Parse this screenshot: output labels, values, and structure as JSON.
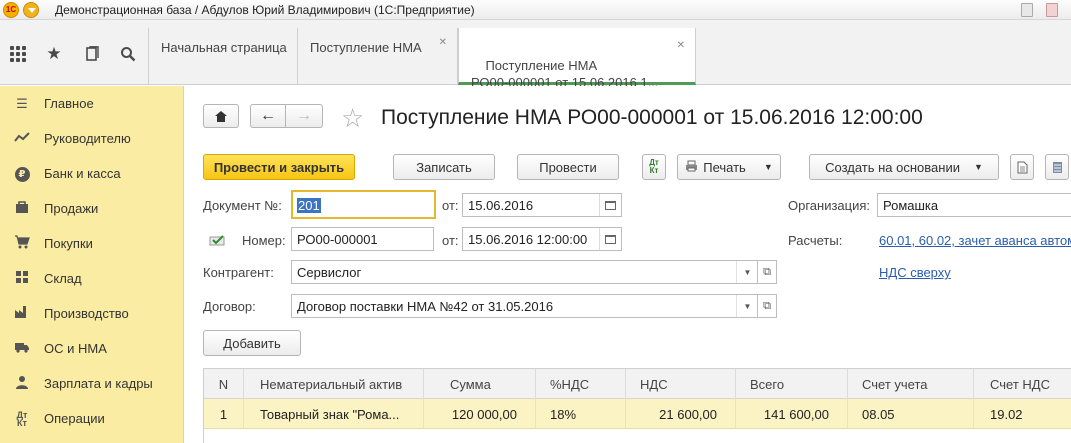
{
  "window": {
    "logo_text": "1С",
    "title": "Демонстрационная база / Абдулов Юрий Владимирович  (1С:Предприятие)"
  },
  "toolbar_icons": [
    "apps-grid-icon",
    "star-icon",
    "history-icon",
    "search-icon"
  ],
  "tabs": [
    {
      "label": "Начальная страница"
    },
    {
      "label": "Поступление НМА"
    },
    {
      "label": "Поступление НМА\nРО00-000001 от 15.06.2016 1..."
    }
  ],
  "sidebar": {
    "items": [
      {
        "label": "Главное",
        "icon": "menu-icon"
      },
      {
        "label": "Руководителю",
        "icon": "trend-icon"
      },
      {
        "label": "Банк и касса",
        "icon": "ruble-icon"
      },
      {
        "label": "Продажи",
        "icon": "bag-icon"
      },
      {
        "label": "Покупки",
        "icon": "cart-icon"
      },
      {
        "label": "Склад",
        "icon": "warehouse-icon"
      },
      {
        "label": "Производство",
        "icon": "factory-icon"
      },
      {
        "label": "ОС и НМА",
        "icon": "truck-icon"
      },
      {
        "label": "Зарплата и кадры",
        "icon": "person-icon"
      },
      {
        "label": "Операции",
        "icon": "dt-kt-icon"
      }
    ]
  },
  "document": {
    "title": "Поступление НМА РО00-000001 от 15.06.2016 12:00:00"
  },
  "actions": {
    "post_close": "Провести и закрыть",
    "save": "Записать",
    "post": "Провести",
    "dtkt": "Дт Кт",
    "print": "Печать",
    "create_based": "Создать на основании"
  },
  "form": {
    "doc_no_label": "Документ №:",
    "doc_no_value": "201",
    "from_label": "от:",
    "doc_date": "15.06.2016",
    "number_label": "Номер:",
    "number_value": "РО00-000001",
    "from_label2": "от:",
    "number_date": "15.06.2016 12:00:00",
    "org_label": "Организация:",
    "org_value": "Ромашка",
    "settlements_label": "Расчеты:",
    "settlements_link": "60.01, 60.02, зачет аванса автом",
    "vat_link": "НДС сверху",
    "counterparty_label": "Контрагент:",
    "counterparty_value": "Сервислог",
    "contract_label": "Договор:",
    "contract_value": "Договор поставки НМА №42 от 31.05.2016",
    "add_button": "Добавить"
  },
  "table": {
    "columns": [
      "N",
      "Нематериальный актив",
      "Сумма",
      "%НДС",
      "НДС",
      "Всего",
      "Счет учета",
      "Счет НДС"
    ],
    "rows": [
      [
        "1",
        "Товарный знак \"Рома...",
        "120 000,00",
        "18%",
        "21 600,00",
        "141 600,00",
        "08.05",
        "19.02"
      ]
    ]
  },
  "colors": {
    "sidebar_bg": "#fbeca4",
    "primary_button": "#f7c513",
    "active_tab_underline": "#4e9a56",
    "link": "#2a5db0",
    "selected_row": "#fbf3c4"
  }
}
